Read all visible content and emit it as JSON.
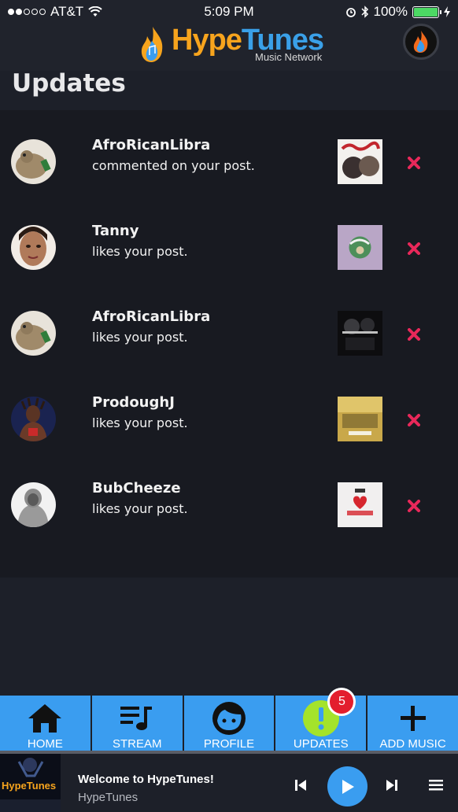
{
  "status_bar": {
    "carrier": "AT&T",
    "time": "5:09 PM",
    "battery": "100%"
  },
  "header": {
    "logo_hype": "Hype",
    "logo_tunes": "Tunes",
    "logo_sub": "Music Network"
  },
  "page": {
    "title": "Updates"
  },
  "updates": [
    {
      "username": "AfroRicanLibra",
      "action": "commented on your post."
    },
    {
      "username": "Tanny",
      "action": "likes your post."
    },
    {
      "username": "AfroRicanLibra",
      "action": "likes your post."
    },
    {
      "username": "ProdoughJ",
      "action": "likes your post."
    },
    {
      "username": "BubCheeze",
      "action": "likes your post."
    }
  ],
  "tabs": {
    "home": "HOME",
    "stream": "STREAM",
    "profile": "PROFILE",
    "updates": "UPDATES",
    "updates_badge": "5",
    "add_music": "ADD MUSIC"
  },
  "player": {
    "art_text": "HypeTunes",
    "title": "Welcome to HypeTunes!",
    "artist": "HypeTunes"
  },
  "colors": {
    "accent": "#3a9df0",
    "dismiss": "#e8285a",
    "badge": "#e31e2d",
    "updates_icon": "#a4e32b"
  }
}
